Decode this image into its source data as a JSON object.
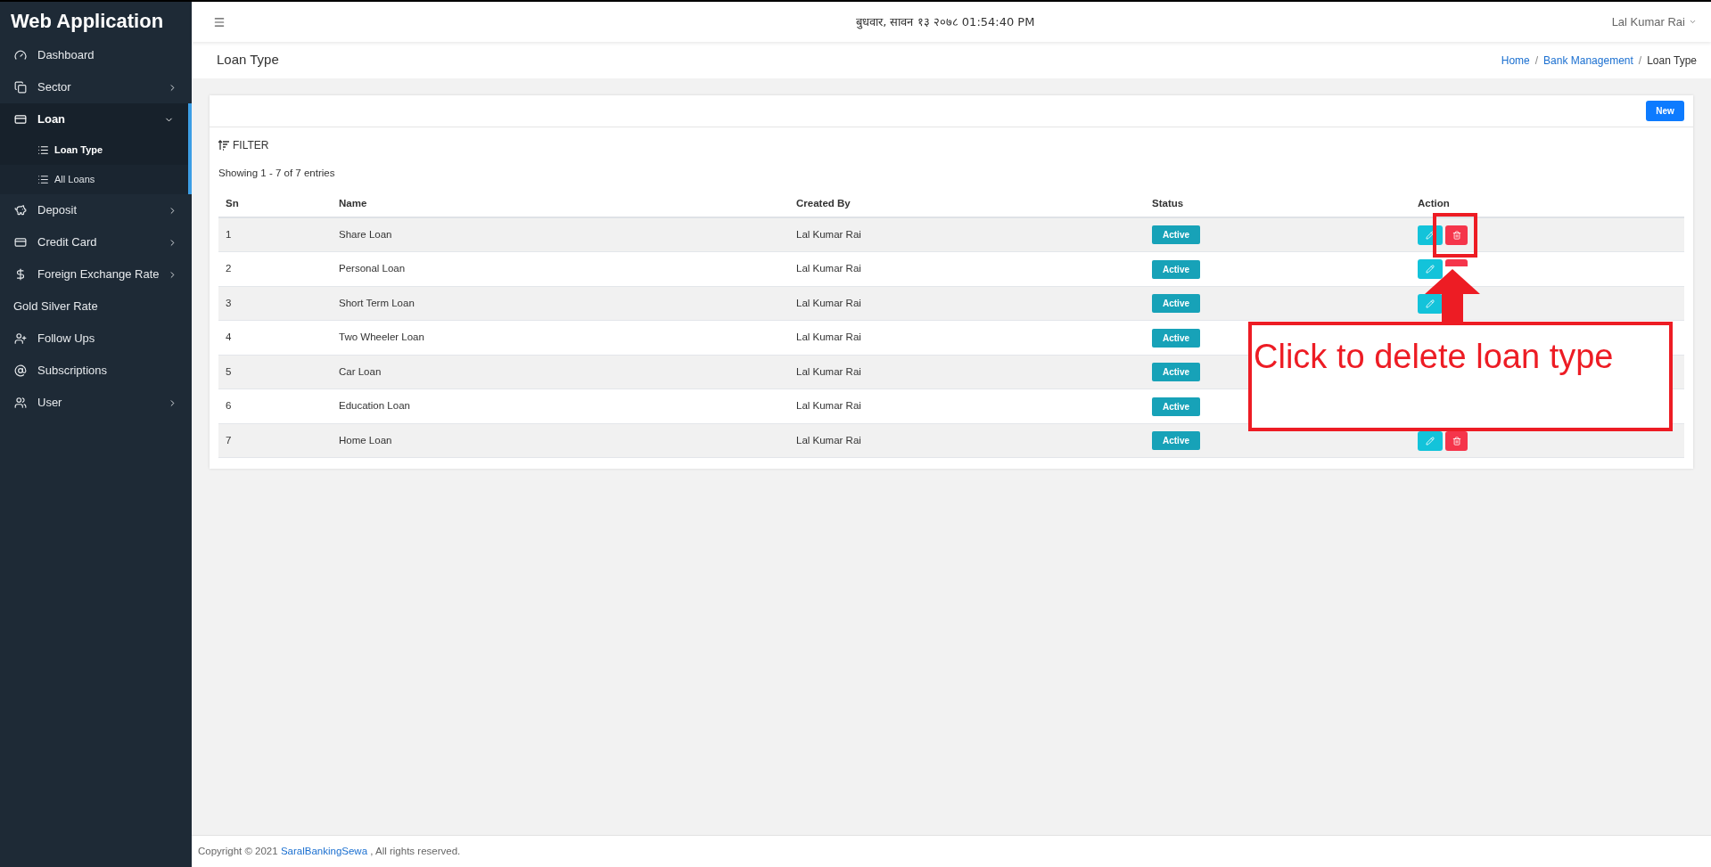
{
  "app_title": "Web Application",
  "sidebar": {
    "items": [
      {
        "label": "Dashboard",
        "expandable": false,
        "expanded": false,
        "selected": false
      },
      {
        "label": "Sector",
        "expandable": true,
        "expanded": false,
        "selected": false
      },
      {
        "label": "Loan",
        "expandable": true,
        "expanded": true,
        "selected": false,
        "children": [
          {
            "label": "Loan Type",
            "selected": true
          },
          {
            "label": "All Loans",
            "selected": false
          }
        ]
      },
      {
        "label": "Deposit",
        "expandable": true,
        "expanded": false,
        "selected": false
      },
      {
        "label": "Credit Card",
        "expandable": true,
        "expanded": false,
        "selected": false
      },
      {
        "label": "Foreign Exchange Rate",
        "expandable": true,
        "expanded": false,
        "selected": false
      },
      {
        "label": "Gold Silver Rate",
        "expandable": false,
        "expanded": false,
        "selected": false
      },
      {
        "label": "Follow Ups",
        "expandable": false,
        "expanded": false,
        "selected": false
      },
      {
        "label": "Subscriptions",
        "expandable": false,
        "expanded": false,
        "selected": false
      },
      {
        "label": "User",
        "expandable": true,
        "expanded": false,
        "selected": false
      }
    ]
  },
  "topbar": {
    "date_time": "बुधवार, सावन १३ २०७८ 01:54:40 PM",
    "user": "Lal Kumar Rai"
  },
  "page_title": "Loan Type",
  "breadcrumb": [
    {
      "label": "Home",
      "link": true,
      "separator": "/"
    },
    {
      "label": "Bank Management",
      "link": true,
      "separator": "/"
    },
    {
      "label": "Loan Type",
      "link": false
    }
  ],
  "card": {
    "new_button": "New",
    "filter_label": "FILTER",
    "showing": "Showing 1 - 7 of 7 entries",
    "table": {
      "columns": [
        "Sn",
        "Name",
        "Created By",
        "Status",
        "Action"
      ],
      "rows": [
        {
          "sn": "1",
          "name": "Share Loan",
          "created_by": "Lal Kumar Rai",
          "status": "Active"
        },
        {
          "sn": "2",
          "name": "Personal Loan",
          "created_by": "Lal Kumar Rai",
          "status": "Active"
        },
        {
          "sn": "3",
          "name": "Short Term Loan",
          "created_by": "Lal Kumar Rai",
          "status": "Active"
        },
        {
          "sn": "4",
          "name": "Two Wheeler Loan",
          "created_by": "Lal Kumar Rai",
          "status": "Active"
        },
        {
          "sn": "5",
          "name": "Car Loan",
          "created_by": "Lal Kumar Rai",
          "status": "Active"
        },
        {
          "sn": "6",
          "name": "Education Loan",
          "created_by": "Lal Kumar Rai",
          "status": "Active"
        },
        {
          "sn": "7",
          "name": "Home Loan",
          "created_by": "Lal Kumar Rai",
          "status": "Active"
        }
      ]
    }
  },
  "footer": {
    "prefix": "Copyright © 2021",
    "link": "SaralBankingSewa",
    "suffix": ", All rights reserved."
  },
  "annotation": {
    "text": "Click to delete loan type"
  }
}
